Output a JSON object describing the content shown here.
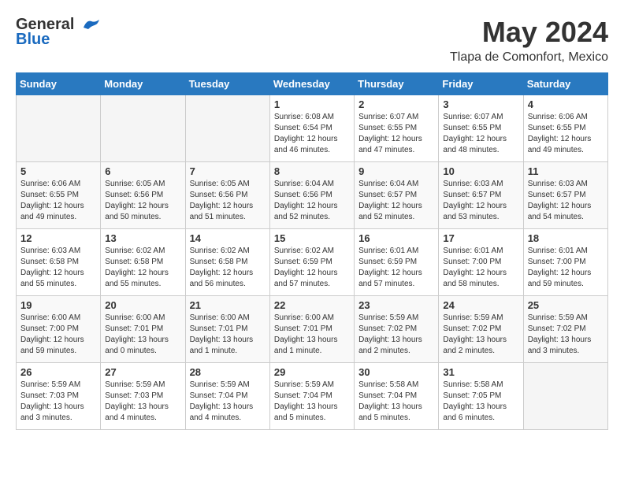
{
  "logo": {
    "general": "General",
    "blue": "Blue"
  },
  "header": {
    "month": "May 2024",
    "location": "Tlapa de Comonfort, Mexico"
  },
  "days_of_week": [
    "Sunday",
    "Monday",
    "Tuesday",
    "Wednesday",
    "Thursday",
    "Friday",
    "Saturday"
  ],
  "weeks": [
    [
      {
        "day": "",
        "info": ""
      },
      {
        "day": "",
        "info": ""
      },
      {
        "day": "",
        "info": ""
      },
      {
        "day": "1",
        "info": "Sunrise: 6:08 AM\nSunset: 6:54 PM\nDaylight: 12 hours\nand 46 minutes."
      },
      {
        "day": "2",
        "info": "Sunrise: 6:07 AM\nSunset: 6:55 PM\nDaylight: 12 hours\nand 47 minutes."
      },
      {
        "day": "3",
        "info": "Sunrise: 6:07 AM\nSunset: 6:55 PM\nDaylight: 12 hours\nand 48 minutes."
      },
      {
        "day": "4",
        "info": "Sunrise: 6:06 AM\nSunset: 6:55 PM\nDaylight: 12 hours\nand 49 minutes."
      }
    ],
    [
      {
        "day": "5",
        "info": "Sunrise: 6:06 AM\nSunset: 6:55 PM\nDaylight: 12 hours\nand 49 minutes."
      },
      {
        "day": "6",
        "info": "Sunrise: 6:05 AM\nSunset: 6:56 PM\nDaylight: 12 hours\nand 50 minutes."
      },
      {
        "day": "7",
        "info": "Sunrise: 6:05 AM\nSunset: 6:56 PM\nDaylight: 12 hours\nand 51 minutes."
      },
      {
        "day": "8",
        "info": "Sunrise: 6:04 AM\nSunset: 6:56 PM\nDaylight: 12 hours\nand 52 minutes."
      },
      {
        "day": "9",
        "info": "Sunrise: 6:04 AM\nSunset: 6:57 PM\nDaylight: 12 hours\nand 52 minutes."
      },
      {
        "day": "10",
        "info": "Sunrise: 6:03 AM\nSunset: 6:57 PM\nDaylight: 12 hours\nand 53 minutes."
      },
      {
        "day": "11",
        "info": "Sunrise: 6:03 AM\nSunset: 6:57 PM\nDaylight: 12 hours\nand 54 minutes."
      }
    ],
    [
      {
        "day": "12",
        "info": "Sunrise: 6:03 AM\nSunset: 6:58 PM\nDaylight: 12 hours\nand 55 minutes."
      },
      {
        "day": "13",
        "info": "Sunrise: 6:02 AM\nSunset: 6:58 PM\nDaylight: 12 hours\nand 55 minutes."
      },
      {
        "day": "14",
        "info": "Sunrise: 6:02 AM\nSunset: 6:58 PM\nDaylight: 12 hours\nand 56 minutes."
      },
      {
        "day": "15",
        "info": "Sunrise: 6:02 AM\nSunset: 6:59 PM\nDaylight: 12 hours\nand 57 minutes."
      },
      {
        "day": "16",
        "info": "Sunrise: 6:01 AM\nSunset: 6:59 PM\nDaylight: 12 hours\nand 57 minutes."
      },
      {
        "day": "17",
        "info": "Sunrise: 6:01 AM\nSunset: 7:00 PM\nDaylight: 12 hours\nand 58 minutes."
      },
      {
        "day": "18",
        "info": "Sunrise: 6:01 AM\nSunset: 7:00 PM\nDaylight: 12 hours\nand 59 minutes."
      }
    ],
    [
      {
        "day": "19",
        "info": "Sunrise: 6:00 AM\nSunset: 7:00 PM\nDaylight: 12 hours\nand 59 minutes."
      },
      {
        "day": "20",
        "info": "Sunrise: 6:00 AM\nSunset: 7:01 PM\nDaylight: 13 hours\nand 0 minutes."
      },
      {
        "day": "21",
        "info": "Sunrise: 6:00 AM\nSunset: 7:01 PM\nDaylight: 13 hours\nand 1 minute."
      },
      {
        "day": "22",
        "info": "Sunrise: 6:00 AM\nSunset: 7:01 PM\nDaylight: 13 hours\nand 1 minute."
      },
      {
        "day": "23",
        "info": "Sunrise: 5:59 AM\nSunset: 7:02 PM\nDaylight: 13 hours\nand 2 minutes."
      },
      {
        "day": "24",
        "info": "Sunrise: 5:59 AM\nSunset: 7:02 PM\nDaylight: 13 hours\nand 2 minutes."
      },
      {
        "day": "25",
        "info": "Sunrise: 5:59 AM\nSunset: 7:02 PM\nDaylight: 13 hours\nand 3 minutes."
      }
    ],
    [
      {
        "day": "26",
        "info": "Sunrise: 5:59 AM\nSunset: 7:03 PM\nDaylight: 13 hours\nand 3 minutes."
      },
      {
        "day": "27",
        "info": "Sunrise: 5:59 AM\nSunset: 7:03 PM\nDaylight: 13 hours\nand 4 minutes."
      },
      {
        "day": "28",
        "info": "Sunrise: 5:59 AM\nSunset: 7:04 PM\nDaylight: 13 hours\nand 4 minutes."
      },
      {
        "day": "29",
        "info": "Sunrise: 5:59 AM\nSunset: 7:04 PM\nDaylight: 13 hours\nand 5 minutes."
      },
      {
        "day": "30",
        "info": "Sunrise: 5:58 AM\nSunset: 7:04 PM\nDaylight: 13 hours\nand 5 minutes."
      },
      {
        "day": "31",
        "info": "Sunrise: 5:58 AM\nSunset: 7:05 PM\nDaylight: 13 hours\nand 6 minutes."
      },
      {
        "day": "",
        "info": ""
      }
    ]
  ]
}
